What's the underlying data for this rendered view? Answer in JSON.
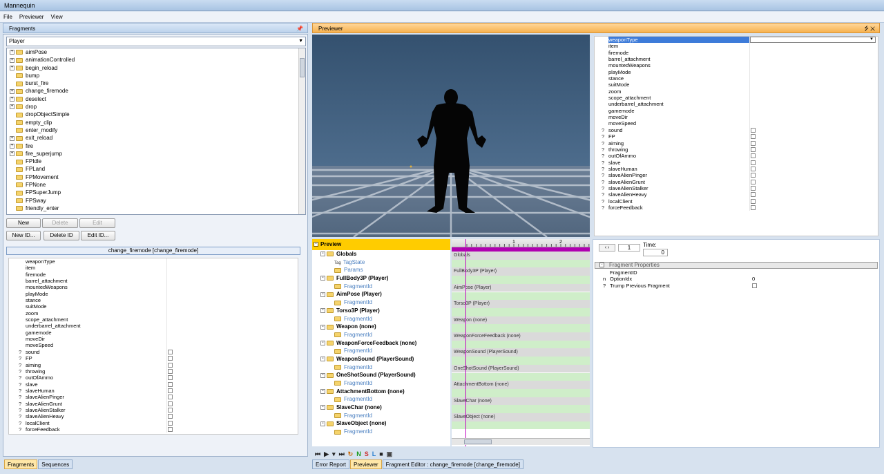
{
  "window": {
    "title": "Mannequin"
  },
  "menu": [
    "File",
    "Previewer",
    "View"
  ],
  "fragments_pane": {
    "title": "Fragments",
    "pin": "⭍",
    "entity_select": "Player",
    "tree": [
      {
        "label": "aimPose",
        "expandable": true
      },
      {
        "label": "animationControlled",
        "expandable": true
      },
      {
        "label": "begin_reload",
        "expandable": true
      },
      {
        "label": "bump",
        "expandable": false
      },
      {
        "label": "burst_fire",
        "expandable": false
      },
      {
        "label": "change_firemode",
        "expandable": true
      },
      {
        "label": "deselect",
        "expandable": true
      },
      {
        "label": "drop",
        "expandable": true
      },
      {
        "label": "dropObjectSimple",
        "expandable": false
      },
      {
        "label": "empty_clip",
        "expandable": false
      },
      {
        "label": "enter_modify",
        "expandable": false
      },
      {
        "label": "exit_reload",
        "expandable": true
      },
      {
        "label": "fire",
        "expandable": true
      },
      {
        "label": "fire_superjump",
        "expandable": true
      },
      {
        "label": "FPIdle",
        "expandable": false
      },
      {
        "label": "FPLand",
        "expandable": false
      },
      {
        "label": "FPMovement",
        "expandable": false
      },
      {
        "label": "FPNone",
        "expandable": false
      },
      {
        "label": "FPSuperJump",
        "expandable": false
      },
      {
        "label": "FPSway",
        "expandable": false
      },
      {
        "label": "friendly_enter",
        "expandable": false
      }
    ],
    "buttons": {
      "new": "New",
      "delete": "Delete",
      "edit": "Edit",
      "new_id": "New ID...",
      "delete_id": "Delete ID",
      "edit_id": "Edit ID..."
    },
    "selected_fragment": "change_firemode [change_firemode]"
  },
  "tag_props": [
    {
      "name": "weaponType",
      "type": "value"
    },
    {
      "name": "item",
      "type": "value"
    },
    {
      "name": "firemode",
      "type": "value"
    },
    {
      "name": "barrel_attachment",
      "type": "value"
    },
    {
      "name": "mountedWeapons",
      "type": "value"
    },
    {
      "name": "playMode",
      "type": "value"
    },
    {
      "name": "stance",
      "type": "value"
    },
    {
      "name": "suitMode",
      "type": "value"
    },
    {
      "name": "zoom",
      "type": "value"
    },
    {
      "name": "scope_attachment",
      "type": "value"
    },
    {
      "name": "underbarrel_attachment",
      "type": "value"
    },
    {
      "name": "gamemode",
      "type": "value"
    },
    {
      "name": "moveDir",
      "type": "value"
    },
    {
      "name": "moveSpeed",
      "type": "value"
    },
    {
      "name": "sound",
      "type": "bool"
    },
    {
      "name": "FP",
      "type": "bool"
    },
    {
      "name": "aiming",
      "type": "bool"
    },
    {
      "name": "throwing",
      "type": "bool"
    },
    {
      "name": "outOfAmmo",
      "type": "bool"
    },
    {
      "name": "slave",
      "type": "bool"
    },
    {
      "name": "slaveHuman",
      "type": "bool"
    },
    {
      "name": "slaveAlienPinger",
      "type": "bool"
    },
    {
      "name": "slaveAlienGrunt",
      "type": "bool"
    },
    {
      "name": "slaveAlienStalker",
      "type": "bool"
    },
    {
      "name": "slaveAlienHeavy",
      "type": "bool"
    },
    {
      "name": "localClient",
      "type": "bool"
    },
    {
      "name": "forceFeedback",
      "type": "bool"
    }
  ],
  "question_mark": "?",
  "previewer": {
    "title": "Previewer",
    "close": "⭍ ✕",
    "tree_header": "Preview",
    "tree": [
      {
        "label": "Globals",
        "kind": "group"
      },
      {
        "label": "TagState",
        "kind": "child",
        "prefix": "Tag"
      },
      {
        "label": "Params",
        "kind": "child"
      },
      {
        "label": "FullBody3P (Player)",
        "kind": "group"
      },
      {
        "label": "FragmentId",
        "kind": "child"
      },
      {
        "label": "AimPose (Player)",
        "kind": "group"
      },
      {
        "label": "FragmentId",
        "kind": "child"
      },
      {
        "label": "Torso3P (Player)",
        "kind": "group"
      },
      {
        "label": "FragmentId",
        "kind": "child"
      },
      {
        "label": "Weapon (none)",
        "kind": "group"
      },
      {
        "label": "FragmentId",
        "kind": "child"
      },
      {
        "label": "WeaponForceFeedback (none)",
        "kind": "group"
      },
      {
        "label": "FragmentId",
        "kind": "child"
      },
      {
        "label": "WeaponSound (PlayerSound)",
        "kind": "group"
      },
      {
        "label": "FragmentId",
        "kind": "child"
      },
      {
        "label": "OneShotSound (PlayerSound)",
        "kind": "group"
      },
      {
        "label": "FragmentId",
        "kind": "child"
      },
      {
        "label": "AttachmentBottom (none)",
        "kind": "group"
      },
      {
        "label": "FragmentId",
        "kind": "child"
      },
      {
        "label": "SlaveChar (none)",
        "kind": "group"
      },
      {
        "label": "FragmentId",
        "kind": "child"
      },
      {
        "label": "SlaveObject (none)",
        "kind": "group"
      },
      {
        "label": "FragmentId",
        "kind": "child"
      }
    ],
    "timeline": {
      "ruler": [
        "1",
        "2"
      ],
      "tracks": [
        "Globals",
        "FullBody3P (Player)",
        "AimPose (Player)",
        "Torso3P (Player)",
        "Weapon (none)",
        "WeaponForceFeedback (none)",
        "WeaponSound (PlayerSound)",
        "OneShotSound (PlayerSound)",
        "AttachmentBottom (none)",
        "SlaveChar (none)",
        "SlaveObject (none)"
      ]
    },
    "time_label": "Time:",
    "time_frame": "1",
    "time_value": "0",
    "fragment_props": {
      "header": "Fragment Properties",
      "rows": [
        {
          "prefix": "",
          "name": "FragmentID",
          "value": ""
        },
        {
          "prefix": "n",
          "name": "OptionIdx",
          "value": "0"
        },
        {
          "prefix": "?",
          "name": "Trump Previous Fragment",
          "value": "",
          "checkbox": true
        }
      ]
    },
    "play_controls": [
      "⏮",
      "▶",
      "▾",
      "⏭",
      "↻",
      "N",
      "S",
      "L",
      "■",
      "▣"
    ]
  },
  "tabs_left": [
    "Fragments",
    "Sequences"
  ],
  "tabs_right": [
    "Error Report",
    "Previewer",
    "Fragment Editor : change_firemode [change_firemode]"
  ],
  "colors": {
    "accent_orange": "#f7b24f",
    "preview_yellow": "#ffcc00",
    "link_blue": "#4a7fc0",
    "selection_blue": "#3d7bd9"
  }
}
